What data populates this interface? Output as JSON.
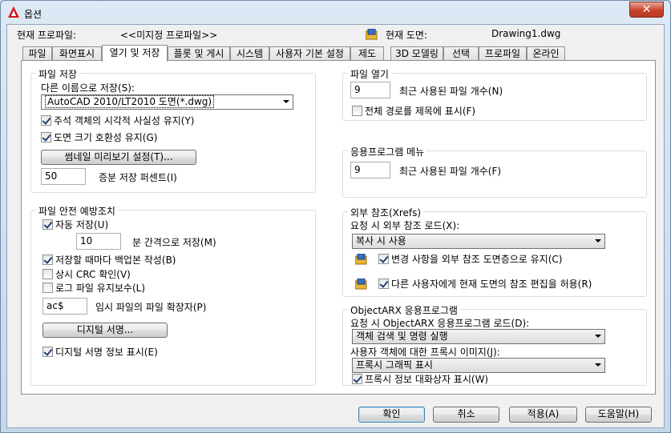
{
  "window": {
    "title": "옵션",
    "close": "✕"
  },
  "header": {
    "profile_label": "현재 프로파일:",
    "profile_value": "<<미지정 프로파일>>",
    "drawing_label": "현재 도면:",
    "drawing_value": "Drawing1.dwg"
  },
  "tabs": [
    "파일",
    "화면표시",
    "열기 및 저장",
    "플롯 및 게시",
    "시스템",
    "사용자 기본 설정",
    "제도",
    "3D 모델링",
    "선택",
    "프로파일",
    "온라인"
  ],
  "file_save": {
    "title": "파일 저장",
    "save_as_label": "다른 이름으로 저장(S):",
    "save_as_value": "AutoCAD 2010/LT2010 도면(*.dwg)",
    "maintain_visual_fidelity": {
      "label": "주석 객체의 시각적 사실성 유지(Y)",
      "checked": true
    },
    "maintain_drawing_size": {
      "label": "도면 크기 호환성 유지(G)",
      "checked": true
    },
    "thumbnail_button": "썸네일 미리보기 설정(T)...",
    "incremental_value": "50",
    "incremental_label": "증분 저장 퍼센트(I)"
  },
  "file_safety": {
    "title": "파일 안전 예방조치",
    "autosave": {
      "label": "자동 저장(U)",
      "checked": true
    },
    "minutes_value": "10",
    "minutes_label": "분 간격으로 저장(M)",
    "backup": {
      "label": "저장할 때마다 백업본 작성(B)",
      "checked": true
    },
    "crc": {
      "label": "상시 CRC 확인(V)",
      "checked": false
    },
    "log": {
      "label": "로그 파일 유지보수(L)",
      "checked": false
    },
    "temp_ext_value": "ac$",
    "temp_ext_label": "임시 파일의 파일 확장자(P)",
    "digital_sig_button": "디지털 서명...",
    "display_sig": {
      "label": "디지털 서명 정보 표시(E)",
      "checked": true
    }
  },
  "file_open": {
    "title": "파일 열기",
    "recent_value": "9",
    "recent_label": "최근 사용된 파일 개수(N)",
    "full_path": {
      "label": "전체 경로를 제목에 표시(F)",
      "checked": false
    }
  },
  "app_menu": {
    "title": "응용프로그램 메뉴",
    "recent_value": "9",
    "recent_label": "최근 사용된 파일 개수(F)"
  },
  "xrefs": {
    "title": "외부 참조(Xrefs)",
    "demand_load_label": "요청 시 외부 참조 로드(X):",
    "demand_load_value": "복사 시 사용",
    "retain_changes": {
      "label": "변경 사항을 외부 참조 도면층으로 유지(C)",
      "checked": true
    },
    "allow_edit": {
      "label": "다른 사용자에게 현재 도면의 참조 편집을 허용(R)",
      "checked": true
    }
  },
  "objectarx": {
    "title": "ObjectARX 응용프로그램",
    "demand_load_label": "요청 시 ObjectARX 응용프로그램 로드(D):",
    "demand_load_value": "객체 검색 및 명령 실행",
    "proxy_label": "사용자 객체에 대한 프록시 이미지(J):",
    "proxy_value": "프록시 그래픽 표시",
    "show_proxy": {
      "label": "프록시 정보 대화상자 표시(W)",
      "checked": true
    }
  },
  "footer": {
    "ok": "확인",
    "cancel": "취소",
    "apply": "적용(A)",
    "help": "도움말(H)"
  }
}
